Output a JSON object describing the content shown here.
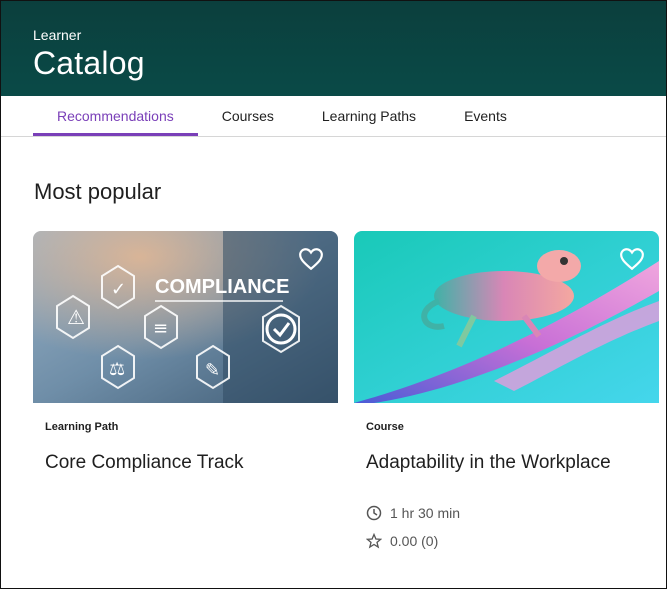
{
  "header": {
    "breadcrumb": "Learner",
    "title": "Catalog"
  },
  "tabs": [
    {
      "label": "Recommendations",
      "active": true
    },
    {
      "label": "Courses",
      "active": false
    },
    {
      "label": "Learning Paths",
      "active": false
    },
    {
      "label": "Events",
      "active": false
    }
  ],
  "section": {
    "title": "Most popular"
  },
  "cards": [
    {
      "type": "Learning Path",
      "title": "Core Compliance Track",
      "image_text": "COMPLIANCE",
      "favorite_icon": "heart-outline-icon"
    },
    {
      "type": "Course",
      "title": "Adaptability in the Workplace",
      "duration": "1 hr 30 min",
      "rating": "0.00 (0)",
      "favorite_icon": "heart-outline-icon"
    }
  ],
  "colors": {
    "header_bg": "#0b3f3d",
    "accent": "#7a3fb8"
  }
}
